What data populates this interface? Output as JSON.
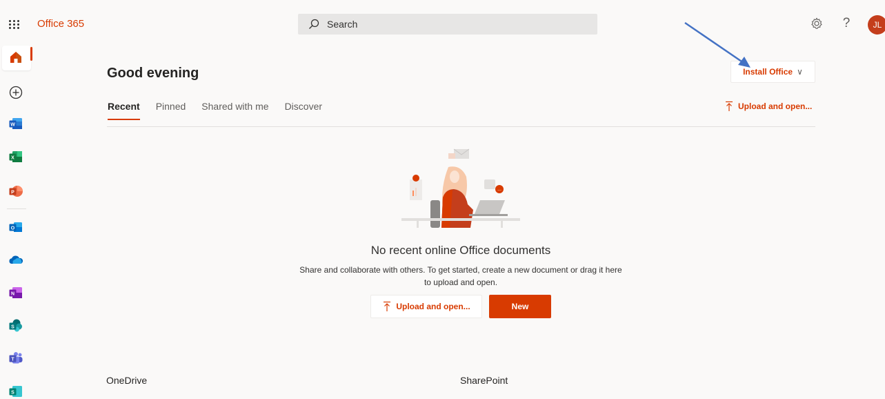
{
  "header": {
    "brand": "Office 365",
    "search_placeholder": "Search",
    "avatar_initials": "JL"
  },
  "main": {
    "greeting": "Good evening",
    "install_button": "Install Office",
    "tabs": [
      {
        "label": "Recent",
        "active": true
      },
      {
        "label": "Pinned",
        "active": false
      },
      {
        "label": "Shared with me",
        "active": false
      },
      {
        "label": "Discover",
        "active": false
      }
    ],
    "upload_open": "Upload and open...",
    "empty_title": "No recent online Office documents",
    "empty_desc_line1": "Share and collaborate with others. To get started, create a new document or drag it here",
    "empty_desc_line2": "to upload and open.",
    "upload_button": "Upload and open...",
    "new_button": "New",
    "sections": [
      "OneDrive",
      "SharePoint"
    ]
  },
  "colors": {
    "accent": "#d83b01",
    "background": "#faf9f8",
    "annotation_arrow": "#4472c4"
  }
}
